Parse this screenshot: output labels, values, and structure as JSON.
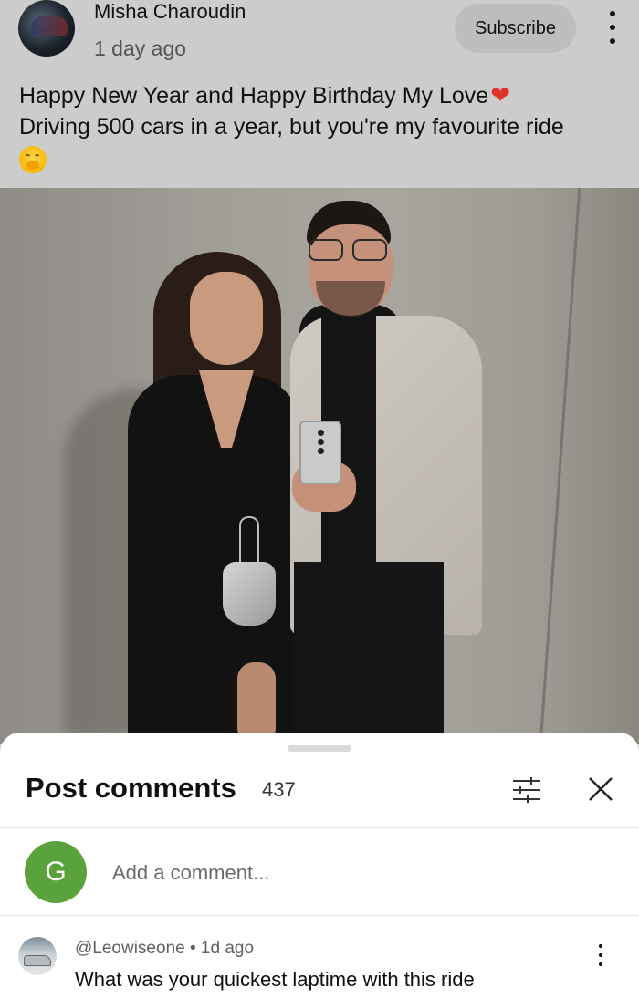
{
  "post": {
    "channel_name": "Misha Charoudin",
    "time_ago": "1 day ago",
    "subscribe_label": "Subscribe",
    "text_line1": "Happy New Year and Happy Birthday My Love",
    "text_line2": "Driving 500 cars in a year, but you're my favourite ride",
    "heart_emoji": "❤"
  },
  "comments_sheet": {
    "title": "Post comments",
    "count": "437",
    "add_comment_placeholder": "Add a comment...",
    "user_initial": "G"
  },
  "comments": [
    {
      "handle": "@Leowiseone",
      "separator": " • ",
      "time": "1d ago",
      "text": "What was your quickest laptime with this ride"
    }
  ],
  "colors": {
    "header_bg": "#cccccc",
    "user_avatar": "#5aa33c",
    "heart": "#e0352b"
  }
}
